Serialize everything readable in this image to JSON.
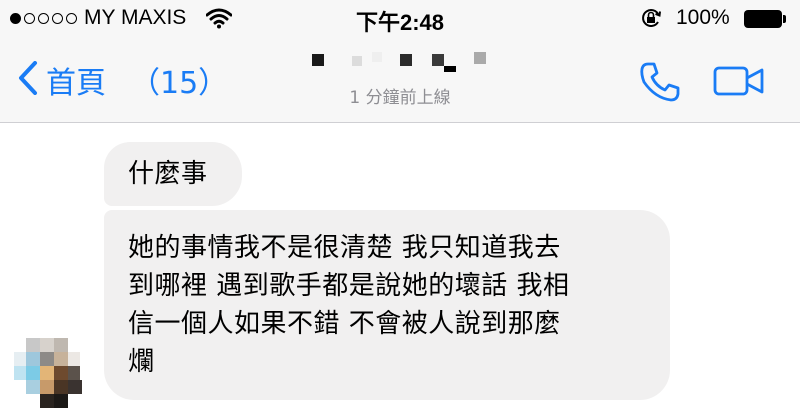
{
  "status_bar": {
    "carrier": "MY MAXIS",
    "time": "下午2:48",
    "battery": "100%",
    "signal_dots_filled": 1,
    "signal_dots_total": 5,
    "icons": [
      "wifi-icon",
      "rotation-lock-icon",
      "battery-icon"
    ]
  },
  "nav": {
    "back_label": "首頁",
    "unread_count": "（15）",
    "last_seen": "1 分鐘前上線",
    "accent_color": "#1a7cf5",
    "icons": [
      "chevron-left-icon",
      "phone-icon",
      "video-camera-icon"
    ]
  },
  "messages": [
    {
      "text": "什麼事"
    },
    {
      "text": "她的事情我不是很清楚 我只知道我去\n到哪裡 遇到歌手都是說她的壞話 我相\n信一個人如果不錯 不會被人說到那麼\n爛"
    }
  ],
  "colors": {
    "bubble_bg": "#f1f0f0",
    "bar_bg": "#f7f7f7"
  }
}
